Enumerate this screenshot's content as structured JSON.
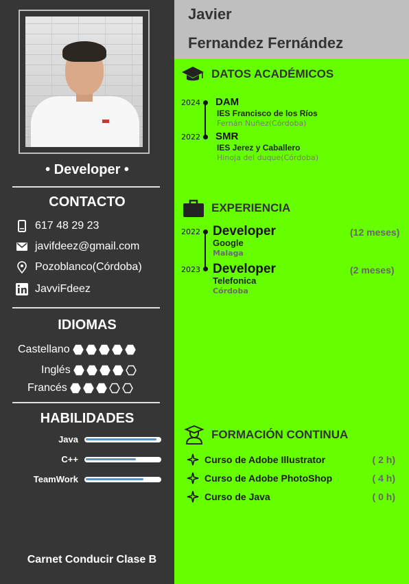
{
  "header": {
    "first_name": "Javier",
    "last_name": "Fernandez Fernández"
  },
  "sidebar": {
    "role": "• Developer •",
    "contact_heading": "CONTACTO",
    "contact": [
      {
        "icon": "phone-icon",
        "text": "617 48 29 23"
      },
      {
        "icon": "mail-icon",
        "text": "javifdeez@gmail.com"
      },
      {
        "icon": "location-icon",
        "text": "Pozoblanco(Córdoba)"
      },
      {
        "icon": "linkedin-icon",
        "text": "JavviFdeez"
      }
    ],
    "languages_heading": "IDIOMAS",
    "languages": [
      {
        "name": "Castellano",
        "level": 5,
        "max": 5
      },
      {
        "name": "Inglés",
        "level": 4,
        "max": 5
      },
      {
        "name": "Francés",
        "level": 3,
        "max": 5
      }
    ],
    "skills_heading": "HABILIDADES",
    "skills": [
      {
        "name": "Java",
        "level": 0.95
      },
      {
        "name": "C++",
        "level": 0.68
      },
      {
        "name": "TeamWork",
        "level": 0.78
      }
    ],
    "license": "Carnet Conducir Clase B"
  },
  "academic": {
    "title": "DATOS ACADÉMICOS",
    "items": [
      {
        "year": "2024",
        "title": "DAM",
        "school": "IES Francisco de los Ríos",
        "place": "Fernán Nuñez(Córdoba)"
      },
      {
        "year": "2022",
        "title": "SMR",
        "school": "IES Jerez y Caballero",
        "place": "Hinoja del duque(Córdoba)"
      }
    ]
  },
  "experience": {
    "title": "EXPERIENCIA",
    "items": [
      {
        "year": "2022",
        "title": "Developer",
        "company": "Google",
        "place": "Malaga",
        "duration": "(12 meses)"
      },
      {
        "year": "2023",
        "title": "Developer",
        "company": "Telefonica",
        "place": "Córdoba",
        "duration": "(2 meses)"
      }
    ]
  },
  "training": {
    "title": "FORMACIÓN CONTINUA",
    "items": [
      {
        "name": "Curso de Adobe Illustrator",
        "hours": "( 2 h)"
      },
      {
        "name": "Curso de Adobe PhotoShop",
        "hours": "( 4 h)"
      },
      {
        "name": "Curso de Java",
        "hours": "( 0 h)"
      }
    ]
  },
  "colors": {
    "sidebar_bg": "#363636",
    "header_bg": "#bfbfbf",
    "main_bg": "#66ff00",
    "skill_fill": "#5a95c8"
  }
}
